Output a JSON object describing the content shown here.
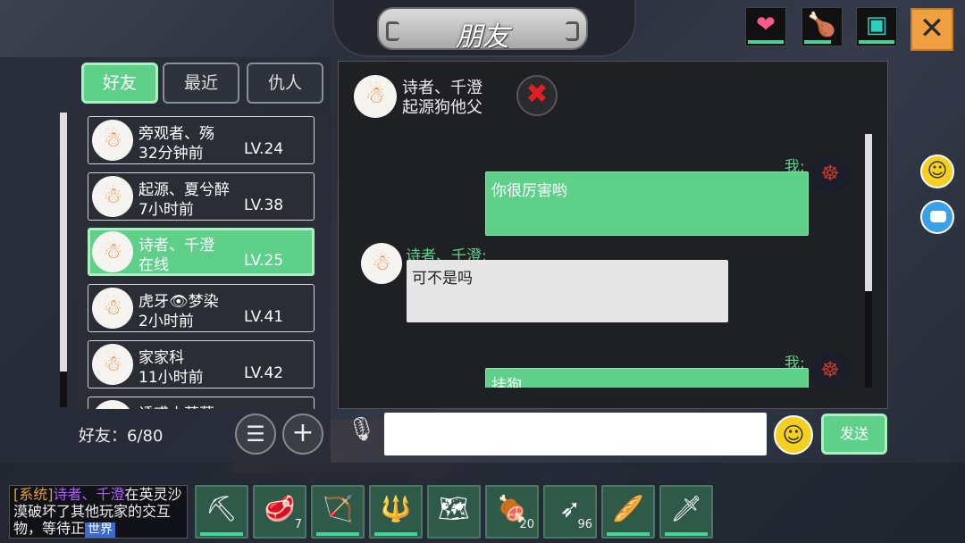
{
  "title": "朋友",
  "top_icons": [
    {
      "name": "heart-icon",
      "glyph": "❤",
      "color": "#ff5a8a"
    },
    {
      "name": "meat-icon",
      "glyph": "🍗",
      "color": "#f0c040"
    },
    {
      "name": "water-icon",
      "glyph": "▣",
      "color": "#2ad0c0"
    }
  ],
  "close_glyph": "✕",
  "tabs": [
    {
      "label": "好友",
      "active": true
    },
    {
      "label": "最近",
      "active": false
    },
    {
      "label": "仇人",
      "active": false
    }
  ],
  "friends": [
    {
      "name": "旁观者、殇",
      "status": "32分钟前",
      "level": "LV.24",
      "active": false
    },
    {
      "name": "起源、夏兮醉",
      "status": "7小时前",
      "level": "LV.38",
      "active": false
    },
    {
      "name": "诗者、千澄",
      "status": "在线",
      "level": "LV.25",
      "active": true
    },
    {
      "name": "虎牙👁梦染",
      "status": "2小时前",
      "level": "LV.41",
      "active": false
    },
    {
      "name": "家家科",
      "status": "11小时前",
      "level": "LV.42",
      "active": false
    },
    {
      "name": "诱惑小萝莉",
      "status": "",
      "level": "",
      "active": false
    }
  ],
  "friend_count": "好友：6/80",
  "chat": {
    "name": "诗者、千澄",
    "subtitle": "起源狗他父",
    "messages": [
      {
        "sender": "我:",
        "text": "你很厉害哟",
        "mine": true
      },
      {
        "sender": "诗者、千澄:",
        "text": "可不是吗",
        "mine": false
      },
      {
        "sender": "我:",
        "text": "挂狗",
        "mine": true
      }
    ]
  },
  "input": {
    "placeholder": ""
  },
  "send_label": "发送",
  "syslog": {
    "tag": "[系统]",
    "player": "诗者、千澄",
    "text": "在英灵沙漠破坏了其他玩家的交互物，等待正",
    "world": "世界"
  },
  "hotbar": [
    {
      "name": "pickaxe-icon",
      "glyph": "⛏",
      "count": ""
    },
    {
      "name": "steak-icon",
      "glyph": "🥩",
      "count": "7"
    },
    {
      "name": "bow-icon",
      "glyph": "🏹",
      "count": ""
    },
    {
      "name": "spear-icon",
      "glyph": "🔱",
      "count": ""
    },
    {
      "name": "map-icon",
      "glyph": "🗺",
      "count": ""
    },
    {
      "name": "roast-meat-icon",
      "glyph": "🍖",
      "count": "20"
    },
    {
      "name": "arrow-icon",
      "glyph": "➶",
      "count": "96"
    },
    {
      "name": "bread-icon",
      "glyph": "🥖",
      "count": ""
    },
    {
      "name": "crystal-sword-icon",
      "glyph": "🗡",
      "count": ""
    }
  ]
}
